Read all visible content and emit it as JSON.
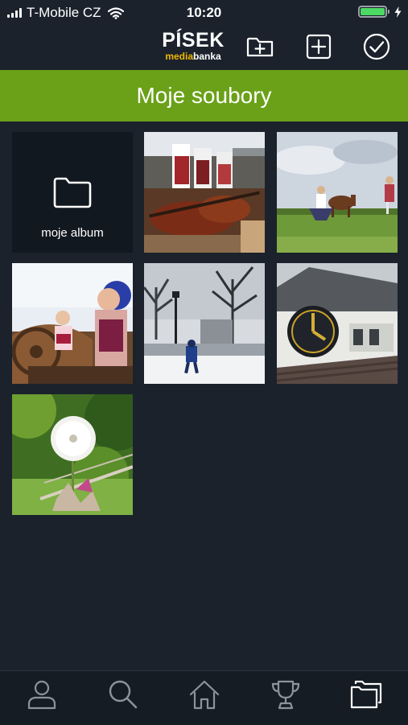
{
  "status_bar": {
    "carrier": "T-Mobile CZ",
    "time": "10:20",
    "battery_percent": 100
  },
  "header": {
    "logo_line1": "PÍSEK",
    "logo_line2_a": "media",
    "logo_line2_b": "banka",
    "actions": [
      "new-folder-icon",
      "add-icon",
      "check-circle-icon"
    ]
  },
  "title": "Moje soubory",
  "album": {
    "label": "moje album",
    "icon": "folder-icon"
  },
  "photos": [
    {
      "name": "photo-violin-folk-dance"
    },
    {
      "name": "photo-folk-dancers-meadow-horse"
    },
    {
      "name": "photo-girl-folk-costume"
    },
    {
      "name": "photo-snowy-street"
    },
    {
      "name": "photo-clock-tower"
    },
    {
      "name": "photo-dandelion"
    }
  ],
  "tabbar": {
    "items": [
      "profile-icon",
      "search-icon",
      "home-icon",
      "trophy-icon",
      "folders-icon"
    ],
    "active": "folders-icon"
  },
  "colors": {
    "background": "#1b222c",
    "accent_green": "#6aa118",
    "logo_yellow": "#f2b700"
  }
}
